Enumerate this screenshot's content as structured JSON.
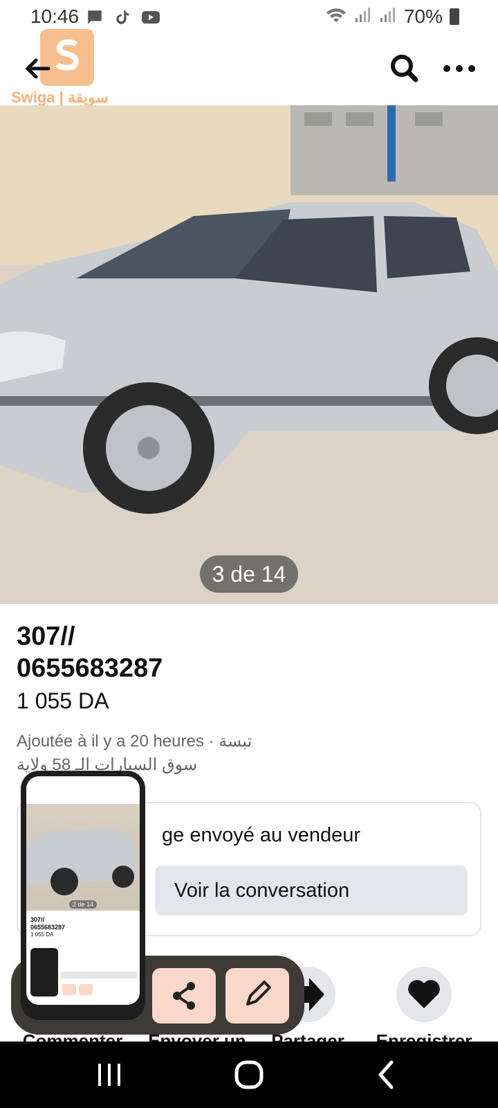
{
  "status_bar": {
    "time": "10:46",
    "battery": "70%"
  },
  "header": {
    "logo_text": "Swiga | سويقة"
  },
  "photo": {
    "counter": "3 de 14"
  },
  "listing": {
    "title": "307//\n0655683287",
    "price": "1 055 DA",
    "meta_line1": "Ajoutée à il y a 20 heures · تبسة",
    "meta_line2": "سوق السيارات الـ 58 ولاية"
  },
  "message_card": {
    "text": "ge envoyé au vendeur",
    "button": "Voir la conversation"
  },
  "actions": [
    {
      "label": "Commenter"
    },
    {
      "label": "Envoyer un"
    },
    {
      "label": "Partager"
    },
    {
      "label": "Enregistrer"
    }
  ],
  "thumbnail": {
    "counter": "2 de 14",
    "title": "307//",
    "phone": "0655683287",
    "price": "1 055 DA"
  },
  "colors": {
    "accent_button": "#fcd8c8",
    "toolbar_bg": "#3e3a35",
    "secondary_button": "#e4e6eb"
  }
}
